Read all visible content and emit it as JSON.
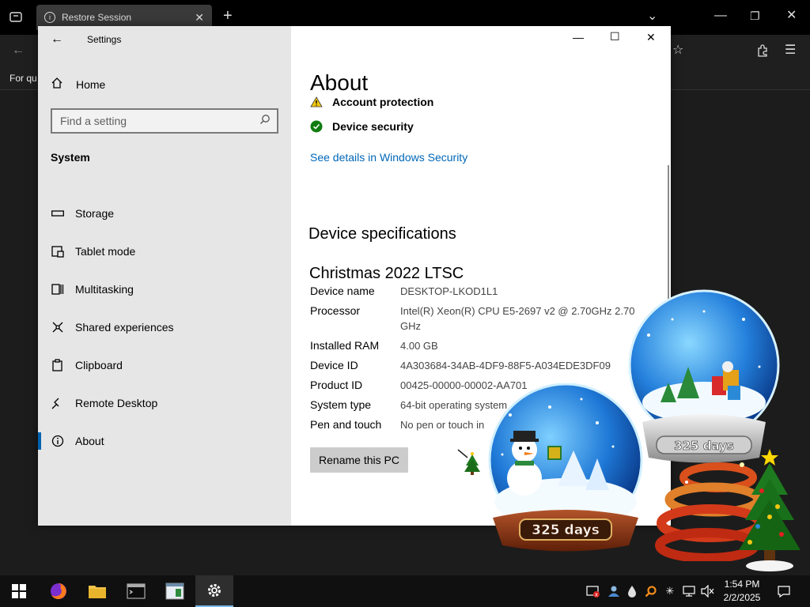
{
  "browser": {
    "tab_title": "Restore Session",
    "bookmarks_text": "For qu"
  },
  "settings": {
    "window_title": "Settings",
    "home_label": "Home",
    "search_placeholder": "Find a setting",
    "section_label": "System",
    "nav_items": [
      {
        "label": "Storage",
        "icon": "storage-icon"
      },
      {
        "label": "Tablet mode",
        "icon": "tablet-icon"
      },
      {
        "label": "Multitasking",
        "icon": "multitasking-icon"
      },
      {
        "label": "Shared experiences",
        "icon": "shared-experiences-icon"
      },
      {
        "label": "Clipboard",
        "icon": "clipboard-icon"
      },
      {
        "label": "Remote Desktop",
        "icon": "remote-desktop-icon"
      },
      {
        "label": "About",
        "icon": "info-icon"
      }
    ],
    "selected_nav": "About"
  },
  "about": {
    "title": "About",
    "security_rows": [
      {
        "label": "Account protection",
        "status": "warning",
        "color": "#f2c811"
      },
      {
        "label": "Device security",
        "status": "ok",
        "color": "#107c10"
      }
    ],
    "see_details_link": "See details in Windows Security",
    "device_specs_heading": "Device specifications",
    "device_edition_heading": "Christmas 2022 LTSC",
    "specs": [
      {
        "label": "Device name",
        "value": "DESKTOP-LKOD1L1"
      },
      {
        "label": "Processor",
        "value": "Intel(R) Xeon(R) CPU E5-2697 v2 @ 2.70GHz   2.70 GHz"
      },
      {
        "label": "Installed RAM",
        "value": "4.00 GB"
      },
      {
        "label": "Device ID",
        "value": "4A303684-34AB-4DF9-88F5-A034EDE3DF09"
      },
      {
        "label": "Product ID",
        "value": "00425-00000-00002-AA701"
      },
      {
        "label": "System type",
        "value": "64-bit operating system"
      },
      {
        "label": "Pen and touch",
        "value": "No pen or touch in"
      }
    ],
    "rename_button": "Rename this PC"
  },
  "decorations": {
    "globe_big_text": "325 days",
    "globe_right_text": "325 days"
  },
  "taskbar": {
    "apps": [
      "firefox-icon",
      "file-explorer-icon",
      "terminal-icon",
      "app-window-icon",
      "settings-gear-icon"
    ],
    "active_app": "settings-gear-icon",
    "time": "1:54 PM",
    "date": "2/2/2025",
    "accent_color": "#76b9ed"
  }
}
